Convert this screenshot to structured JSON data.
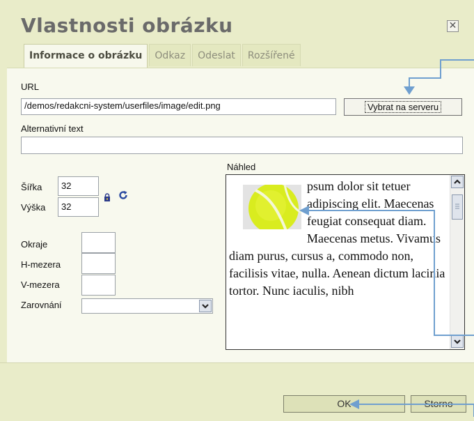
{
  "dialog": {
    "title": "Vlastnosti obrázku",
    "close_glyph": "✕"
  },
  "tabs": [
    {
      "label": "Informace o obrázku",
      "active": true
    },
    {
      "label": "Odkaz",
      "active": false
    },
    {
      "label": "Odeslat",
      "active": false
    },
    {
      "label": "Rozšířené",
      "active": false
    }
  ],
  "image_info": {
    "url_label": "URL",
    "url_value": "/demos/redakcni-system/userfiles/image/edit.png",
    "browse_label": "Vybrat na serveru",
    "alt_label": "Alternativní text",
    "alt_value": "",
    "width_label": "Šířka",
    "width_value": "32",
    "height_label": "Výška",
    "height_value": "32",
    "border_label": "Okraje",
    "border_value": "",
    "hspace_label": "H-mezera",
    "hspace_value": "",
    "vspace_label": "V-mezera",
    "vspace_value": "",
    "align_label": "Zarovnání",
    "align_value": ""
  },
  "preview": {
    "label": "Náhled",
    "text": "psum dolor sit tetuer adipiscing elit. Maecenas feugiat consequat diam. Maecenas metus. Vivamus diam purus, cursus a, commodo non, facilisis vitae, nulla. Aenean dictum lacinia tortor. Nunc iaculis, nibh"
  },
  "footer": {
    "ok_label": "OK",
    "cancel_label": "Storno"
  },
  "icons": {
    "lock": "lock-icon",
    "reset": "reset-size-icon",
    "close": "close-icon"
  },
  "colors": {
    "dialog_bg": "#e9ecc9",
    "panel_bg": "#f8f9ee",
    "annotation_arrow": "#6f9fcf"
  }
}
